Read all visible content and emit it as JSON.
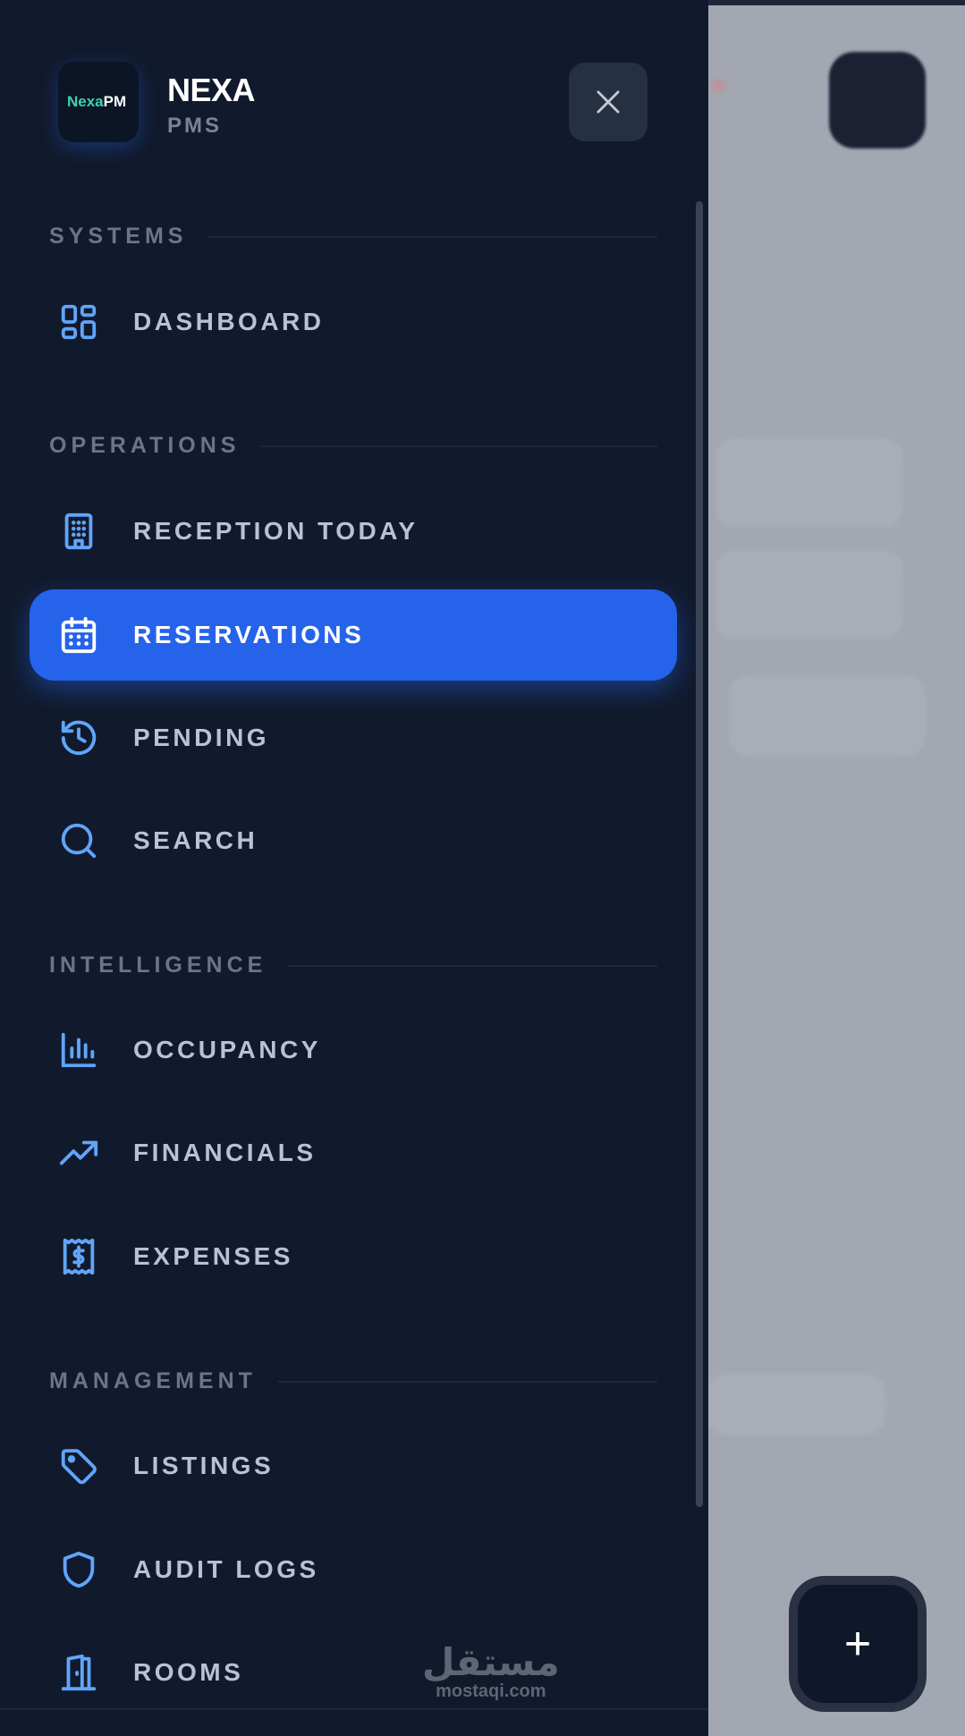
{
  "colors": {
    "drawer_bg": "#111a2c",
    "accent": "#2563eb",
    "icon_blue": "#60a5fa",
    "section_label": "#6b7588",
    "item_label": "#b9c2d2"
  },
  "brand": {
    "logo_text_green": "Nexa",
    "logo_text_white": "PM",
    "name": "NEXA",
    "subtitle": "PMS"
  },
  "header": {
    "close_icon": "close-icon"
  },
  "sections": {
    "systems": "SYSTEMS",
    "operations": "OPERATIONS",
    "intelligence": "INTELLIGENCE",
    "management": "MANAGEMENT"
  },
  "nav": {
    "dashboard": {
      "label": "DASHBOARD",
      "icon": "grid-icon"
    },
    "reception": {
      "label": "RECEPTION TODAY",
      "icon": "building-icon"
    },
    "reservations": {
      "label": "RESERVATIONS",
      "icon": "calendar-icon",
      "active": true
    },
    "pending": {
      "label": "PENDING",
      "icon": "history-icon"
    },
    "search": {
      "label": "SEARCH",
      "icon": "search-icon"
    },
    "occupancy": {
      "label": "OCCUPANCY",
      "icon": "bar-chart-icon"
    },
    "financials": {
      "label": "FINANCIALS",
      "icon": "trending-up-icon"
    },
    "expenses": {
      "label": "EXPENSES",
      "icon": "receipt-icon"
    },
    "listings": {
      "label": "LISTINGS",
      "icon": "tag-icon"
    },
    "audit_logs": {
      "label": "AUDIT LOGS",
      "icon": "shield-icon"
    },
    "rooms": {
      "label": "ROOMS",
      "icon": "door-icon"
    }
  },
  "fab": {
    "symbol": "+"
  },
  "watermark": {
    "arabic": "مستقل",
    "latin": "mostaqi.com"
  }
}
